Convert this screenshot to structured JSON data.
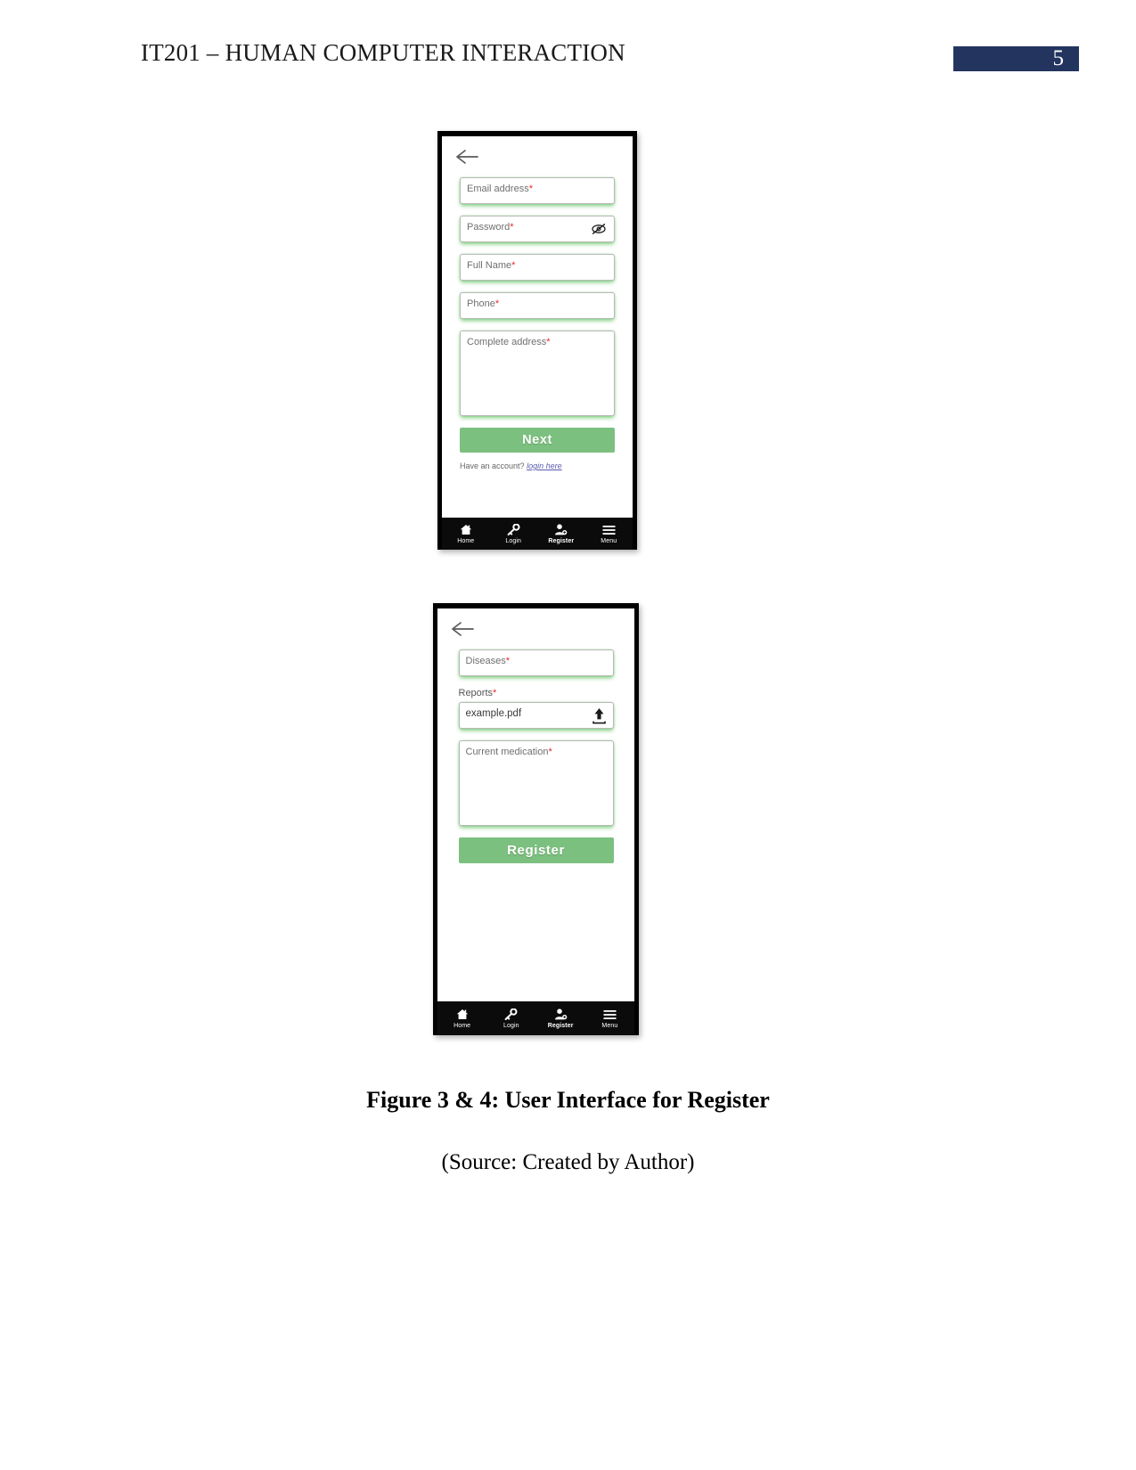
{
  "header": {
    "title": "IT201 – HUMAN COMPUTER INTERACTION",
    "page_number": "5",
    "badge_color": "#23355f"
  },
  "theme": {
    "accent_green": "#7cc07f",
    "required_red": "#e8282b",
    "nav_background": "#0b0b0b",
    "link_color": "#5b5bb0"
  },
  "screen_one": {
    "name": "register-step-1",
    "back_icon": "back-arrow-icon",
    "fields": [
      {
        "label": "Email address",
        "required": "*",
        "type": "input",
        "value": ""
      },
      {
        "label": "Password",
        "required": "*",
        "type": "input",
        "value": "",
        "trailing_icon": "eye-slash-icon"
      },
      {
        "label": "Full Name",
        "required": "*",
        "type": "input",
        "value": ""
      },
      {
        "label": "Phone",
        "required": "*",
        "type": "input",
        "value": ""
      },
      {
        "label": "Complete address",
        "required": "*",
        "type": "textarea",
        "value": ""
      }
    ],
    "primary_button": "Next",
    "account_prompt": "Have an account?",
    "account_link": "login here"
  },
  "screen_two": {
    "name": "register-step-2",
    "back_icon": "back-arrow-icon",
    "diseases": {
      "label": "Diseases",
      "required": "*",
      "value": ""
    },
    "reports_label": "Reports",
    "reports_required": "*",
    "reports_value": "example.pdf",
    "upload_icon": "upload-icon",
    "medication": {
      "label": "Current medication",
      "required": "*",
      "value": ""
    },
    "primary_button": "Register"
  },
  "bottom_nav": {
    "items": [
      {
        "label": "Home",
        "icon": "home-icon",
        "active": false
      },
      {
        "label": "Login",
        "icon": "key-icon",
        "active": false
      },
      {
        "label": "Register",
        "icon": "person-add-icon",
        "active": true
      },
      {
        "label": "Menu",
        "icon": "hamburger-menu-icon",
        "active": false
      }
    ]
  },
  "captions": {
    "figure": "Figure 3 & 4: User Interface for Register",
    "source": "(Source: Created by Author)"
  }
}
